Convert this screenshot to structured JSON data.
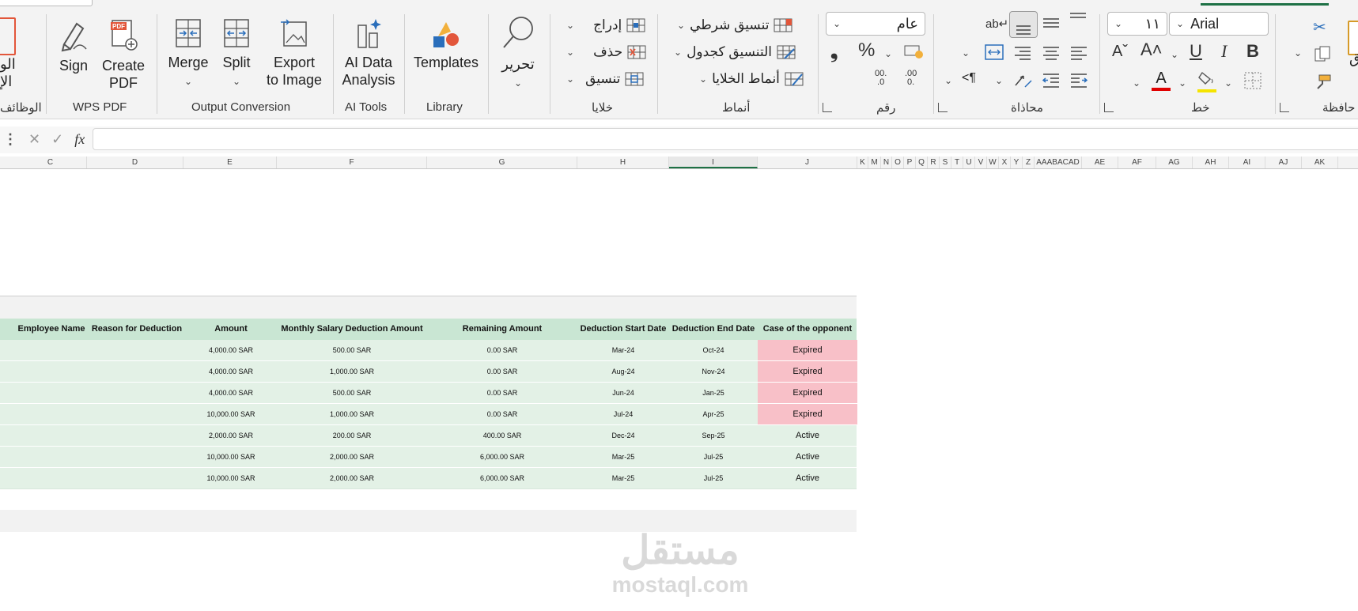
{
  "ribbon": {
    "groups": {
      "functions": "الوظائف",
      "wps_pdf": "WPS PDF",
      "output_conversion": "Output Conversion",
      "ai_tools": "AI Tools",
      "library": "Library",
      "cells": "خلايا",
      "styles": "أنماط",
      "number": "رقم",
      "alignment": "محاذاة",
      "font": "خط",
      "clipboard": "حافظة"
    },
    "buttons": {
      "functions_cut_line1": "الو",
      "functions_cut_line2": "الإ",
      "sign": "Sign",
      "create_pdf_1": "Create",
      "create_pdf_2": "PDF",
      "merge": "Merge",
      "split": "Split",
      "export_1": "Export",
      "export_2": "to Image",
      "ai_data_1": "AI Data",
      "ai_data_2": "Analysis",
      "templates": "Templates",
      "edit": "تحرير",
      "insert": "إدراج",
      "delete": "حذف",
      "format": "تنسيق",
      "conditional_formatting": "تنسيق شرطي",
      "format_as_table": "التنسيق كجدول",
      "cell_styles": "أنماط الخلايا",
      "paste_cut": "ق",
      "clipboard_cut": "حافظة"
    },
    "number_format": "عام",
    "font_name": "Arial",
    "font_size": "١١",
    "percent": "%",
    "comma": "❟",
    "dec_inc_top": ".00",
    "dec_inc_bottom": "0.",
    "dec_dec_top": "00.",
    "dec_dec_bottom": ".0",
    "bold": "B",
    "italic": "I",
    "underline": "U"
  },
  "formula_bar": {
    "fx": "fx",
    "value": ""
  },
  "columns": [
    "C",
    "D",
    "E",
    "F",
    "G",
    "H",
    "I",
    "J",
    "K",
    "M",
    "N",
    "O",
    "P",
    "Q",
    "R",
    "S",
    "T",
    "U",
    "V",
    "W",
    "X",
    "Y",
    "Z",
    "AAABACAD",
    "AE",
    "AF",
    "AG",
    "AH",
    "AI",
    "AJ",
    "AK"
  ],
  "selected_column": "I",
  "table": {
    "headers": [
      "Employee Name",
      "Reason for Deduction",
      "Amount",
      "Monthly Salary Deduction Amount",
      "Remaining Amount",
      "Deduction Start Date",
      "Deduction End Date",
      "Case of the opponent"
    ],
    "rows": [
      {
        "amount": "4,000.00 SAR",
        "monthly": "500.00 SAR",
        "remaining": "0.00 SAR",
        "start": "Mar-24",
        "end": "Oct-24",
        "status": "Expired"
      },
      {
        "amount": "4,000.00 SAR",
        "monthly": "1,000.00 SAR",
        "remaining": "0.00 SAR",
        "start": "Aug-24",
        "end": "Nov-24",
        "status": "Expired"
      },
      {
        "amount": "4,000.00 SAR",
        "monthly": "500.00 SAR",
        "remaining": "0.00 SAR",
        "start": "Jun-24",
        "end": "Jan-25",
        "status": "Expired"
      },
      {
        "amount": "10,000.00 SAR",
        "monthly": "1,000.00 SAR",
        "remaining": "0.00 SAR",
        "start": "Jul-24",
        "end": "Apr-25",
        "status": "Expired"
      },
      {
        "amount": "2,000.00 SAR",
        "monthly": "200.00 SAR",
        "remaining": "400.00 SAR",
        "start": "Dec-24",
        "end": "Sep-25",
        "status": "Active"
      },
      {
        "amount": "10,000.00 SAR",
        "monthly": "2,000.00 SAR",
        "remaining": "6,000.00 SAR",
        "start": "Mar-25",
        "end": "Jul-25",
        "status": "Active"
      },
      {
        "amount": "10,000.00 SAR",
        "monthly": "2,000.00 SAR",
        "remaining": "6,000.00 SAR",
        "start": "Mar-25",
        "end": "Jul-25",
        "status": "Active"
      }
    ]
  },
  "colors": {
    "header_fill": "#c9e6d3",
    "row_fill": "#e3f1e6",
    "expired_fill": "#f8c0c8",
    "accent": "#1e7145"
  },
  "watermark": {
    "arabic": "مستقل",
    "latin": "mostaql.com"
  }
}
